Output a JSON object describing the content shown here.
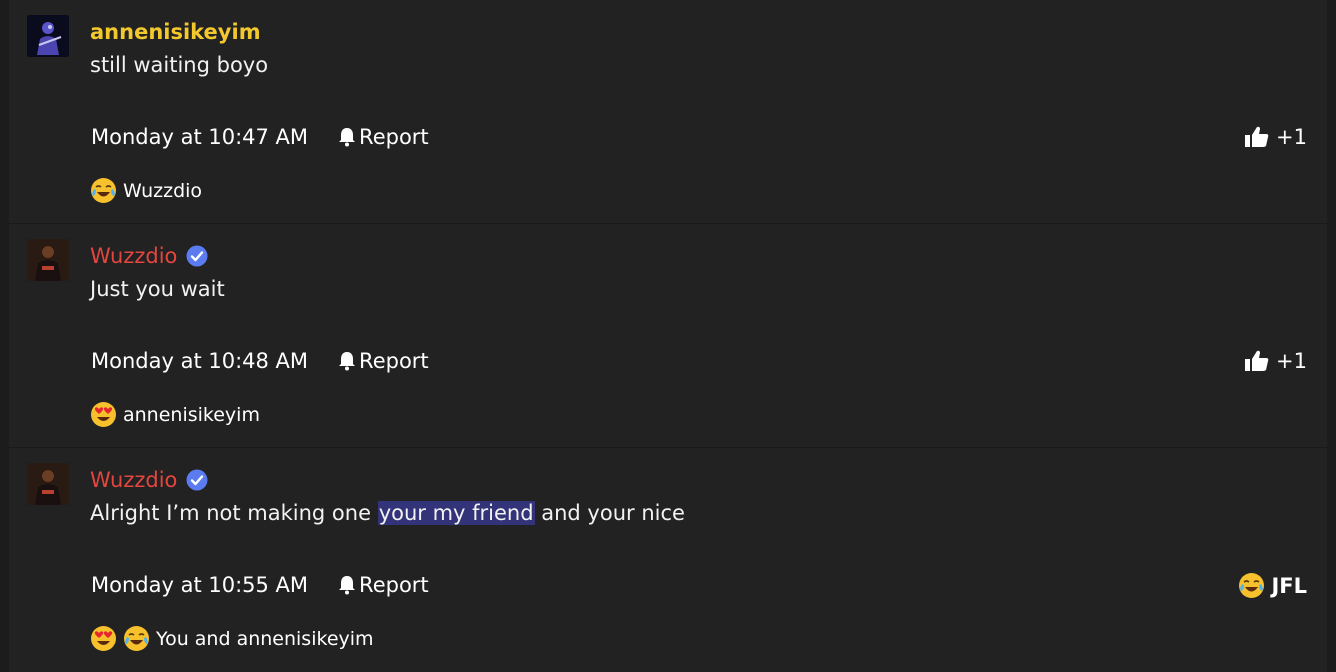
{
  "posts": [
    {
      "username": "annenisikeyim",
      "message": "still waiting boyo",
      "timestamp": "Monday at 10:47 AM",
      "report_label": "Report",
      "reaction_count": "+1",
      "reactors": "Wuzzdio",
      "reactor_emojis": [
        "laughing-crying-emoji"
      ]
    },
    {
      "username": "Wuzzdio",
      "message": "Just you wait",
      "timestamp": "Monday at 10:48 AM",
      "report_label": "Report",
      "reaction_count": "+1",
      "reactors": "annenisikeyim",
      "reactor_emojis": [
        "heart-eyes-emoji"
      ]
    },
    {
      "username": "Wuzzdio",
      "message_before": "Alright I’m not making one ",
      "message_highlight": "your my friend",
      "message_after": " and your nice",
      "timestamp": "Monday at 10:55 AM",
      "report_label": "Report",
      "reaction_label": "JFL",
      "reactors": "You and annenisikeyim",
      "reactor_emojis": [
        "heart-eyes-emoji",
        "laughing-crying-emoji"
      ]
    }
  ],
  "colors": {
    "background": "#222222",
    "username_gold": "#f3c82d",
    "username_red": "#e3463f",
    "verified_blue": "#5b7cf0",
    "highlight": "#33337a"
  }
}
